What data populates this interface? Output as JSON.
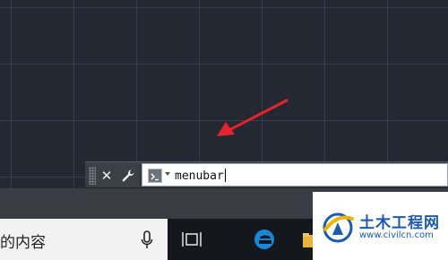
{
  "command_line": {
    "input_value": "menubar",
    "close_icon": "close-icon",
    "customize_icon": "wrench-icon",
    "prompt_icon": "command-prompt-icon"
  },
  "taskbar": {
    "search_text": "的内容",
    "icons": [
      "microphone-icon",
      "task-view-icon",
      "edge-icon",
      "folder-icon"
    ]
  },
  "watermark": {
    "title": "土木工程网",
    "url": "www.civilcn.com"
  },
  "colors": {
    "canvas": "#232833",
    "arrow": "#e8232c",
    "command_bar": "#3b3f46",
    "taskbar": "#14171c",
    "edge_blue": "#1a86d8",
    "watermark_blue": "#1a5bb0"
  }
}
